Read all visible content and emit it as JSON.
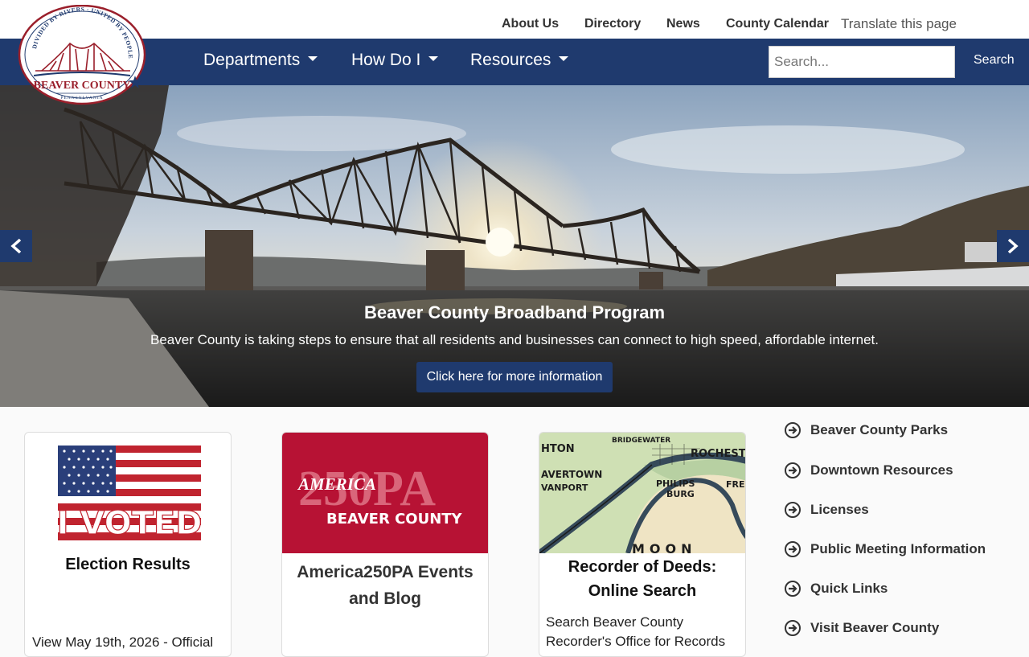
{
  "utility": {
    "links": [
      "About Us",
      "Directory",
      "News",
      "County Calendar"
    ],
    "translate": "Translate this page"
  },
  "logo": {
    "arc_text": "DIVIDED BY RIVERS · UNITED BY PEOPLE",
    "name": "BEAVER COUNTY",
    "state": "PENNSYLVANIA"
  },
  "nav": {
    "items": [
      "Departments",
      "How Do I",
      "Resources"
    ],
    "search_placeholder": "Search...",
    "search_button": "Search"
  },
  "hero": {
    "title": "Beaver County Broadband Program",
    "subtitle": "Beaver County is taking steps to ensure that all residents and businesses can connect to high speed, affordable internet.",
    "button": "Click here for more information"
  },
  "cards": [
    {
      "image_text": "I VOTED",
      "title": "Election Results",
      "text": "View May 19th, 2026 - Official"
    },
    {
      "image_text_big": "250PA",
      "image_text_overlay": "AMERICA",
      "image_text_small": "BEAVER COUNTY",
      "title_line1": "America250PA Events",
      "title_line2": "and Blog"
    },
    {
      "map_labels": [
        "BRIDGEWATER",
        "ROCHESTE",
        "HTON",
        "AVERTOWN",
        "VANPORT",
        "PHILIPS",
        "BURG",
        "FRE",
        "MOON"
      ],
      "title_line1": "Recorder of Deeds:",
      "title_line2": "Online Search",
      "text_line1": "Search Beaver County",
      "text_line2": "Recorder's Office for Records"
    }
  ],
  "quick_links": [
    "Beaver County Parks",
    "Downtown Resources",
    "Licenses",
    "Public Meeting Information",
    "Quick Links",
    "Visit Beaver County"
  ],
  "colors": {
    "navy": "#1f3a6e",
    "america_red": "#b71234"
  }
}
